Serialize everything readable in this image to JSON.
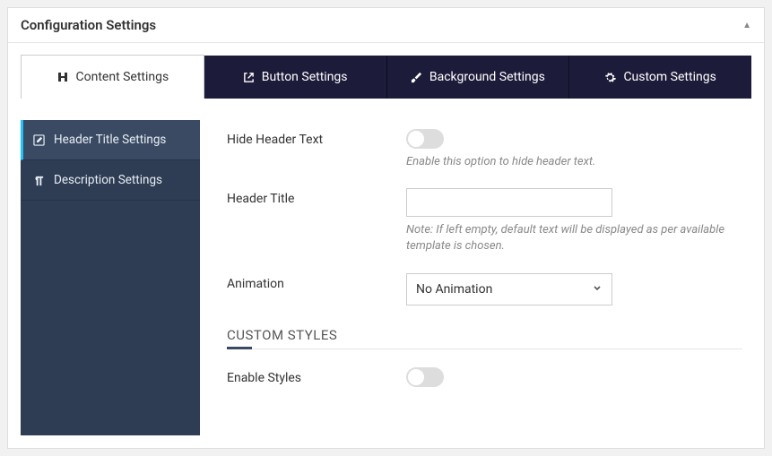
{
  "panel": {
    "title": "Configuration Settings"
  },
  "tabs": [
    {
      "id": "content",
      "label": "Content Settings",
      "active": true
    },
    {
      "id": "button",
      "label": "Button Settings",
      "active": false
    },
    {
      "id": "background",
      "label": "Background Settings",
      "active": false
    },
    {
      "id": "custom",
      "label": "Custom Settings",
      "active": false
    }
  ],
  "sidebar": {
    "items": [
      {
        "id": "header-title",
        "label": "Header Title Settings",
        "active": true
      },
      {
        "id": "description",
        "label": "Description Settings",
        "active": false
      }
    ]
  },
  "fields": {
    "hide_header_text": {
      "label": "Hide Header Text",
      "value": false,
      "help": "Enable this option to hide header text."
    },
    "header_title": {
      "label": "Header Title",
      "value": "",
      "note": "Note: If left empty, default text will be displayed as per available template is chosen."
    },
    "animation": {
      "label": "Animation",
      "selected": "No Animation"
    },
    "custom_styles_heading": "CUSTOM STYLES",
    "enable_styles": {
      "label": "Enable Styles",
      "value": false
    }
  }
}
